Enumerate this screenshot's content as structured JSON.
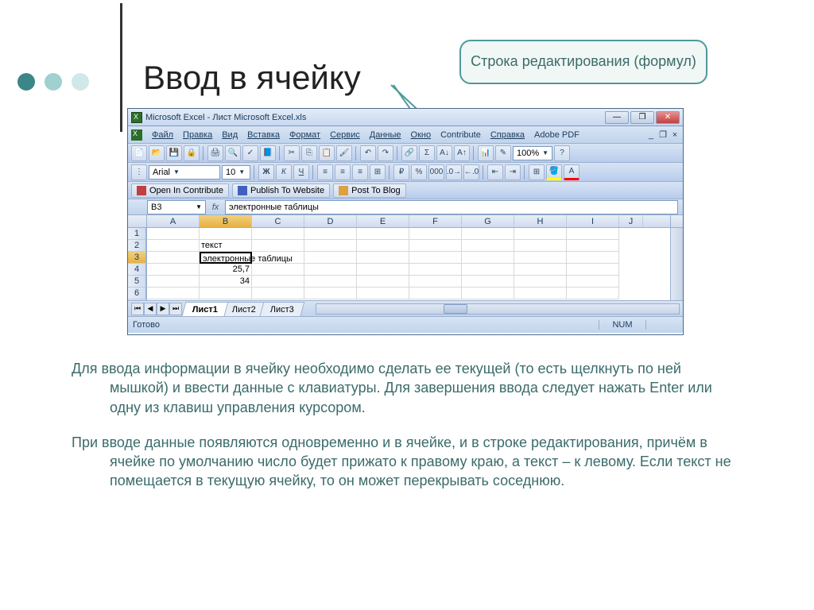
{
  "slide": {
    "title": "Ввод в ячейку",
    "callout": "Строка редактирования (формул)",
    "para1": "Для ввода информации в ячейку необходимо сделать ее текущей (то есть щелкнуть по ней мышкой)  и ввести данные с клавиатуры. Для завершения ввода следует нажать Enter или одну из клавиш управления курсором.",
    "para2": "При вводе данные появляются одновременно и в ячейке, и в строке редактирования, причём в ячейке по умолчанию число будет прижато к правому краю, а текст – к левому. Если текст не помещается в текущую ячейку, то он может перекрывать соседнюю."
  },
  "window": {
    "title": "Microsoft Excel - Лист Microsoft Excel.xls",
    "min": "—",
    "max": "❐",
    "close": "✕"
  },
  "menu": {
    "items": [
      "Файл",
      "Правка",
      "Вид",
      "Вставка",
      "Формат",
      "Сервис",
      "Данные",
      "Окно",
      "Contribute",
      "Справка",
      "Adobe PDF"
    ]
  },
  "toolbar1": {
    "font": "Arial",
    "size": "10",
    "zoom": "100%",
    "help": "?"
  },
  "contribute": {
    "open": "Open In Contribute",
    "publish": "Publish To Website",
    "post": "Post To Blog"
  },
  "formula": {
    "namebox": "B3",
    "fx": "fx",
    "value": "электронные таблицы"
  },
  "grid": {
    "cols": [
      "A",
      "B",
      "C",
      "D",
      "E",
      "F",
      "G",
      "H",
      "I",
      "J"
    ],
    "rows": [
      "1",
      "2",
      "3",
      "4",
      "5",
      "6"
    ],
    "active_col": "B",
    "active_row": "3",
    "cells": {
      "B2": "текст",
      "B3": "электронные таблицы",
      "B4": "25,7",
      "B5": "34"
    }
  },
  "sheets": {
    "tabs": [
      "Лист1",
      "Лист2",
      "Лист3"
    ],
    "active": "Лист1"
  },
  "status": {
    "ready": "Готово",
    "num": "NUM"
  }
}
